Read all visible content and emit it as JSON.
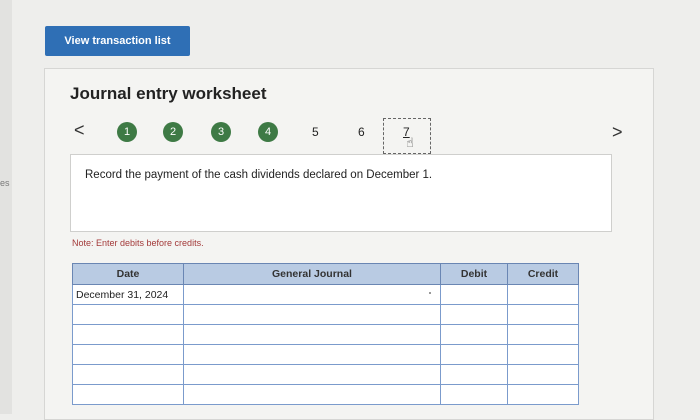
{
  "left_strip_text": "es",
  "header": {
    "view_button_label": "View transaction list"
  },
  "worksheet": {
    "title": "Journal entry worksheet",
    "prev_arrow": "<",
    "next_arrow": ">",
    "steps": [
      "1",
      "2",
      "3",
      "4",
      "5",
      "6",
      "7"
    ],
    "current_step": "7",
    "instruction": "Record the payment of the cash dividends declared on December 1.",
    "note": "Note: Enter debits before credits."
  },
  "table": {
    "headers": {
      "date": "Date",
      "general_journal": "General Journal",
      "debit": "Debit",
      "credit": "Credit"
    },
    "rows": [
      {
        "date": "December 31, 2024",
        "account": "",
        "debit": "",
        "credit": ""
      },
      {
        "date": "",
        "account": "",
        "debit": "",
        "credit": ""
      },
      {
        "date": "",
        "account": "",
        "debit": "",
        "credit": ""
      },
      {
        "date": "",
        "account": "",
        "debit": "",
        "credit": ""
      },
      {
        "date": "",
        "account": "",
        "debit": "",
        "credit": ""
      },
      {
        "date": "",
        "account": "",
        "debit": "",
        "credit": ""
      }
    ]
  },
  "colors": {
    "button": "#2f6fb5",
    "step_completed": "#3e7a45",
    "table_header": "#b9cbe3",
    "note_text": "#a33a3a"
  }
}
